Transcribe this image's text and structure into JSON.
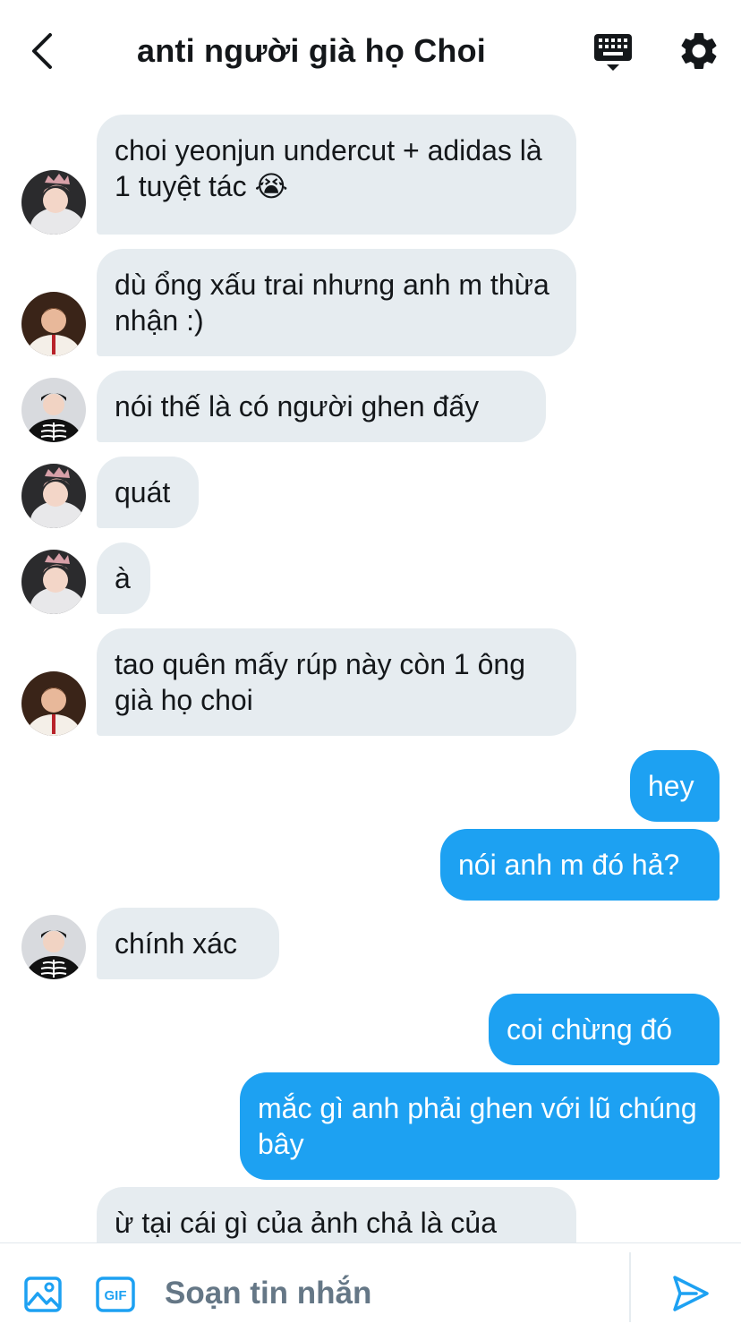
{
  "header": {
    "title": "anti người già họ Choi",
    "icons": {
      "back": "chevron-left-icon",
      "keyboard": "keyboard-icon",
      "settings": "gear-icon"
    }
  },
  "colors": {
    "accent": "#1da1f2",
    "incoming_bubble": "#e6ecf0",
    "text": "#14171a",
    "muted": "#657786"
  },
  "messages": [
    {
      "from": "in",
      "avatar": "crown-avatar",
      "text": "choi yeonjun undercut + adidas là 1 tuyệt tác 😭"
    },
    {
      "from": "in",
      "avatar": "warm-avatar",
      "text": "dù ổng xấu trai nhưng anh m thừa nhận :)"
    },
    {
      "from": "in",
      "avatar": "skeleton-avatar",
      "text": "nói thế là có người ghen đấy"
    },
    {
      "from": "in",
      "avatar": "crown-avatar",
      "text": "quát"
    },
    {
      "from": "in",
      "avatar": "crown-avatar",
      "text": "à"
    },
    {
      "from": "in",
      "avatar": "warm-avatar",
      "text": "tao quên mấy rúp này còn 1 ông già họ choi"
    },
    {
      "from": "out",
      "text": "hey"
    },
    {
      "from": "out",
      "text": "nói anh m đó hả?"
    },
    {
      "from": "in",
      "avatar": "skeleton-avatar",
      "text": "chính xác"
    },
    {
      "from": "out",
      "text": "coi chừng đó"
    },
    {
      "from": "out",
      "text": "mắc gì anh phải ghen với lũ chúng bây"
    },
    {
      "from": "in",
      "text": "ừ tại cái gì của ảnh chả là của"
    }
  ],
  "composer": {
    "placeholder": "Soạn tin nhắn",
    "gif_label": "GIF",
    "icons": {
      "image": "image-icon",
      "gif": "gif-icon",
      "send": "send-icon"
    }
  }
}
